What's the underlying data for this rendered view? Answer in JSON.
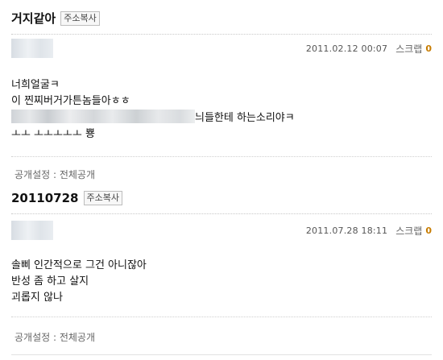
{
  "posts": [
    {
      "title": "거지같아",
      "copy_label": "주소복사",
      "date": "2011.02.12 00:07",
      "scrap_label": "스크랩",
      "scrap_count": "0",
      "lines": [
        "너희얼굴ㅋ",
        "이 찐찌버거가튼놈들아ㅎㅎ",
        "늬들한테 하는소리야ㅋ",
        "ㅗㅗ ㅗㅗㅗㅗㅗ 뿅"
      ],
      "settings": "공개설정 : 전체공개"
    },
    {
      "title": "20110728",
      "copy_label": "주소복사",
      "date": "2011.07.28 18:11",
      "scrap_label": "스크랩",
      "scrap_count": "0",
      "lines": [
        "솔삐 인간적으로 그건 아니잖아",
        "반성 좀 하고 살지",
        "괴롭지 않나"
      ],
      "settings": "공개설정 : 전체공개"
    }
  ]
}
